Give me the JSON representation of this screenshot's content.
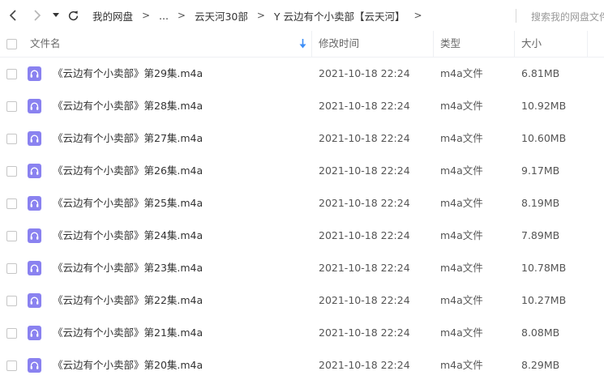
{
  "toolbar": {
    "breadcrumbs": [
      "我的网盘",
      "...",
      "云天河30部",
      "Y 云边有个小卖部【云天河】"
    ],
    "search_placeholder": "搜索我的网盘文件"
  },
  "columns": {
    "name": "文件名",
    "modified": "修改时间",
    "type": "类型",
    "size": "大小"
  },
  "files": [
    {
      "name": "《云边有个小卖部》第29集.m4a",
      "modified": "2021-10-18 22:24",
      "type": "m4a文件",
      "size": "6.81MB"
    },
    {
      "name": "《云边有个小卖部》第28集.m4a",
      "modified": "2021-10-18 22:24",
      "type": "m4a文件",
      "size": "10.92MB"
    },
    {
      "name": "《云边有个小卖部》第27集.m4a",
      "modified": "2021-10-18 22:24",
      "type": "m4a文件",
      "size": "10.60MB"
    },
    {
      "name": "《云边有个小卖部》第26集.m4a",
      "modified": "2021-10-18 22:24",
      "type": "m4a文件",
      "size": "9.17MB"
    },
    {
      "name": "《云边有个小卖部》第25集.m4a",
      "modified": "2021-10-18 22:24",
      "type": "m4a文件",
      "size": "8.19MB"
    },
    {
      "name": "《云边有个小卖部》第24集.m4a",
      "modified": "2021-10-18 22:24",
      "type": "m4a文件",
      "size": "7.89MB"
    },
    {
      "name": "《云边有个小卖部》第23集.m4a",
      "modified": "2021-10-18 22:24",
      "type": "m4a文件",
      "size": "10.78MB"
    },
    {
      "name": "《云边有个小卖部》第22集.m4a",
      "modified": "2021-10-18 22:24",
      "type": "m4a文件",
      "size": "10.27MB"
    },
    {
      "name": "《云边有个小卖部》第21集.m4a",
      "modified": "2021-10-18 22:24",
      "type": "m4a文件",
      "size": "8.08MB"
    },
    {
      "name": "《云边有个小卖部》第20集.m4a",
      "modified": "2021-10-18 22:24",
      "type": "m4a文件",
      "size": "8.29MB"
    }
  ],
  "icons": {
    "back": "chevron-left-icon",
    "forward": "chevron-right-icon",
    "history": "caret-down-icon",
    "refresh": "refresh-icon",
    "sort": "sort-down-arrow-icon",
    "file": "audio-file-icon"
  },
  "colors": {
    "file_icon": "#8a82f0",
    "sort_arrow": "#3d8ef7"
  }
}
